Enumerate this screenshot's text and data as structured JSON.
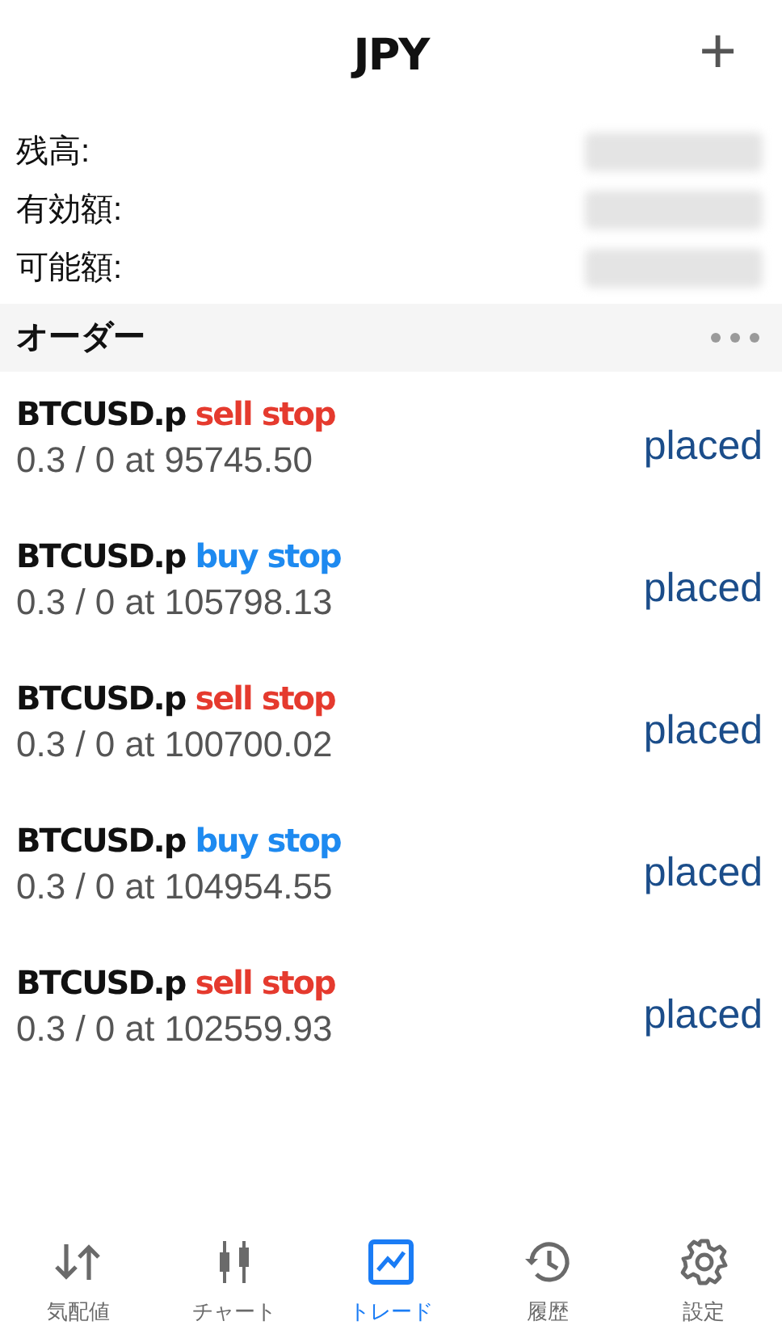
{
  "header": {
    "title": "JPY",
    "add_button": "+"
  },
  "account": [
    {
      "label": "残高:",
      "value_hidden": true
    },
    {
      "label": "有効額:",
      "value_hidden": true
    },
    {
      "label": "可能額:",
      "value_hidden": true
    }
  ],
  "orders_section": {
    "title": "オーダー"
  },
  "orders": [
    {
      "symbol": "BTCUSD.p",
      "type": "sell stop",
      "kind": "sell",
      "detail": "0.3 / 0 at 95745.50",
      "status": "placed"
    },
    {
      "symbol": "BTCUSD.p",
      "type": "buy stop",
      "kind": "buy",
      "detail": "0.3 / 0 at 105798.13",
      "status": "placed"
    },
    {
      "symbol": "BTCUSD.p",
      "type": "sell stop",
      "kind": "sell",
      "detail": "0.3 / 0 at 100700.02",
      "status": "placed"
    },
    {
      "symbol": "BTCUSD.p",
      "type": "buy stop",
      "kind": "buy",
      "detail": "0.3 / 0 at 104954.55",
      "status": "placed"
    },
    {
      "symbol": "BTCUSD.p",
      "type": "sell stop",
      "kind": "sell",
      "detail": "0.3 / 0 at 102559.93",
      "status": "placed"
    }
  ],
  "tab_bar": [
    {
      "label": "気配値",
      "kind": "quotes",
      "selected": false
    },
    {
      "label": "チャート",
      "kind": "chart",
      "selected": false
    },
    {
      "label": "トレード",
      "kind": "trade",
      "selected": true
    },
    {
      "label": "履歴",
      "kind": "history",
      "selected": false
    },
    {
      "label": "設定",
      "kind": "settings",
      "selected": false
    }
  ]
}
